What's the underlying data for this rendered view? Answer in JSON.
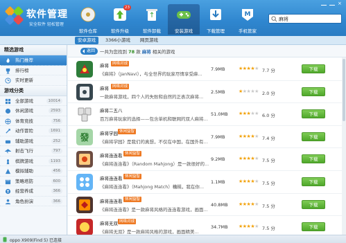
{
  "app": {
    "title": "软件管理",
    "slogan": "安全软件 轻松管理"
  },
  "nav": [
    {
      "label": "软件仓库",
      "icon": "disc-icon"
    },
    {
      "label": "软件升级",
      "icon": "upgrade-icon",
      "badge": "23"
    },
    {
      "label": "软件卸载",
      "icon": "recycle-bin-icon"
    },
    {
      "label": "安装游戏",
      "icon": "game-controller-icon"
    },
    {
      "label": "下载管理",
      "icon": "download-icon"
    },
    {
      "label": "手机管家",
      "icon": "phone-manager-icon"
    }
  ],
  "search": {
    "value": "麻将"
  },
  "subtabs": [
    "安卓游戏",
    "3366小游戏",
    "网页游戏"
  ],
  "sidebar": {
    "featured_title": "精选游戏",
    "featured": [
      {
        "label": "热门推荐",
        "icon": "flame-icon"
      },
      {
        "label": "排行榜",
        "icon": "trophy-icon"
      },
      {
        "label": "实时更新",
        "icon": "clock-icon"
      }
    ],
    "category_title": "游戏分类",
    "categories": [
      {
        "label": "全部游戏",
        "count": "10014",
        "icon": "grid-icon"
      },
      {
        "label": "休闲游戏",
        "count": "2593",
        "icon": "casual-icon"
      },
      {
        "label": "体育竞技",
        "count": "756",
        "icon": "sports-icon"
      },
      {
        "label": "动作冒险",
        "count": "1691",
        "icon": "action-icon"
      },
      {
        "label": "辅助游戏",
        "count": "252",
        "icon": "helper-icon"
      },
      {
        "label": "射击飞行",
        "count": "797",
        "icon": "shooting-icon"
      },
      {
        "label": "棋牌游戏",
        "count": "1193",
        "icon": "chess-icon"
      },
      {
        "label": "模拟辅助",
        "count": "456",
        "icon": "simulation-icon"
      },
      {
        "label": "策略塔防",
        "count": "600",
        "icon": "strategy-icon"
      },
      {
        "label": "经营养成",
        "count": "366",
        "icon": "business-icon"
      },
      {
        "label": "角色扮演",
        "count": "366",
        "icon": "rpg-icon"
      }
    ]
  },
  "results": {
    "back_label": "返回",
    "prefix": "一共为您找到",
    "count": "78",
    "mid": "款",
    "keyword": "麻将",
    "suffix": "相关的游戏"
  },
  "apps": [
    {
      "name": "麻将",
      "tag": "网络对战",
      "desc": "《麻将》（JanNavi），与全世界的玩家尽情享受麻...",
      "size": "7.9MB",
      "stars": 4,
      "score": "7.7 分",
      "download": "下载"
    },
    {
      "name": "麻将",
      "tag": "网络对战",
      "desc": "一款麻将游戏，四个人的失败和自然的正表次麻将...",
      "size": "2.5MB",
      "stars": 1,
      "score": "2.0 分",
      "download": "下载"
    },
    {
      "name": "麻将二五八",
      "tag": "",
      "desc": "百万麻将玩家的选择——包含单机和联网的双人麻将游戏...",
      "size": "51.0MB",
      "stars": 3,
      "score": "6.0 分",
      "download": "下载"
    },
    {
      "name": "麻将学园",
      "tag": "休闲益智",
      "desc": "《麻将学园》是我们的真想，不仅在中国，在国外有更多...",
      "size": "7.9MB",
      "stars": 4,
      "score": "7.4 分",
      "download": "下载"
    },
    {
      "name": "麻将连连看",
      "tag": "休闲益智",
      "desc": "《麻将连连看》（Random Mahjong）是一款很好的...",
      "size": "9.2MB",
      "stars": 4,
      "score": "7.5 分",
      "download": "下载"
    },
    {
      "name": "麻将连连看",
      "tag": "休闲益智",
      "desc": "《麻将连连看》（Mahjong Match）糟糕，我在你...",
      "size": "1.1MB",
      "stars": 4,
      "score": "7.5 分",
      "download": "下载"
    },
    {
      "name": "麻将连连看",
      "tag": "休闲益智",
      "desc": "《麻将连连看》是一款麻将风格的连连看游戏，画面...",
      "size": "40.8MB",
      "stars": 4,
      "score": "7.5 分",
      "download": "下载"
    },
    {
      "name": "麻将无双",
      "tag": "网络对战",
      "desc": "《麻将无双》是一款麻将风格的游戏，画面精美...",
      "size": "34.7MB",
      "stars": 4,
      "score": "7.5 分",
      "download": "下载"
    }
  ],
  "status": {
    "device": "oppo X909(Find 5) 已连接"
  },
  "colors": {
    "accent": "#2f86cf",
    "download_green": "#4fa72b",
    "tag_orange": "#ee7a24",
    "star": "#f2a20c"
  }
}
